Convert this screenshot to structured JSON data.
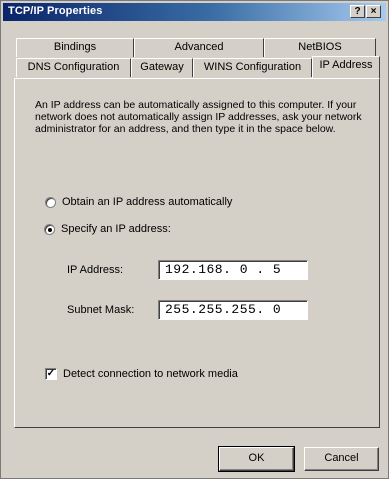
{
  "window": {
    "title": "TCP/IP Properties",
    "help_label": "?",
    "close_label": "×"
  },
  "tabs_row1": [
    {
      "label": "Bindings"
    },
    {
      "label": "Advanced"
    },
    {
      "label": "NetBIOS"
    }
  ],
  "tabs_row2": [
    {
      "label": "DNS Configuration"
    },
    {
      "label": "Gateway"
    },
    {
      "label": "WINS Configuration"
    },
    {
      "label": "IP Address",
      "active": true
    }
  ],
  "description": "An IP address can be automatically assigned to this computer. If your network does not automatically assign IP addresses, ask your network administrator for an address, and then type it in the space below.",
  "radio_obtain": {
    "label": "Obtain an IP address automatically",
    "checked": false
  },
  "radio_specify": {
    "label": "Specify an IP address:",
    "checked": true
  },
  "ip_address": {
    "label": "IP Address:",
    "value": "192.168. 0 . 5"
  },
  "subnet_mask": {
    "label": "Subnet Mask:",
    "value": "255.255.255. 0"
  },
  "detect_media": {
    "label": "Detect connection to network media",
    "checked": true
  },
  "buttons": {
    "ok": "OK",
    "cancel": "Cancel"
  }
}
